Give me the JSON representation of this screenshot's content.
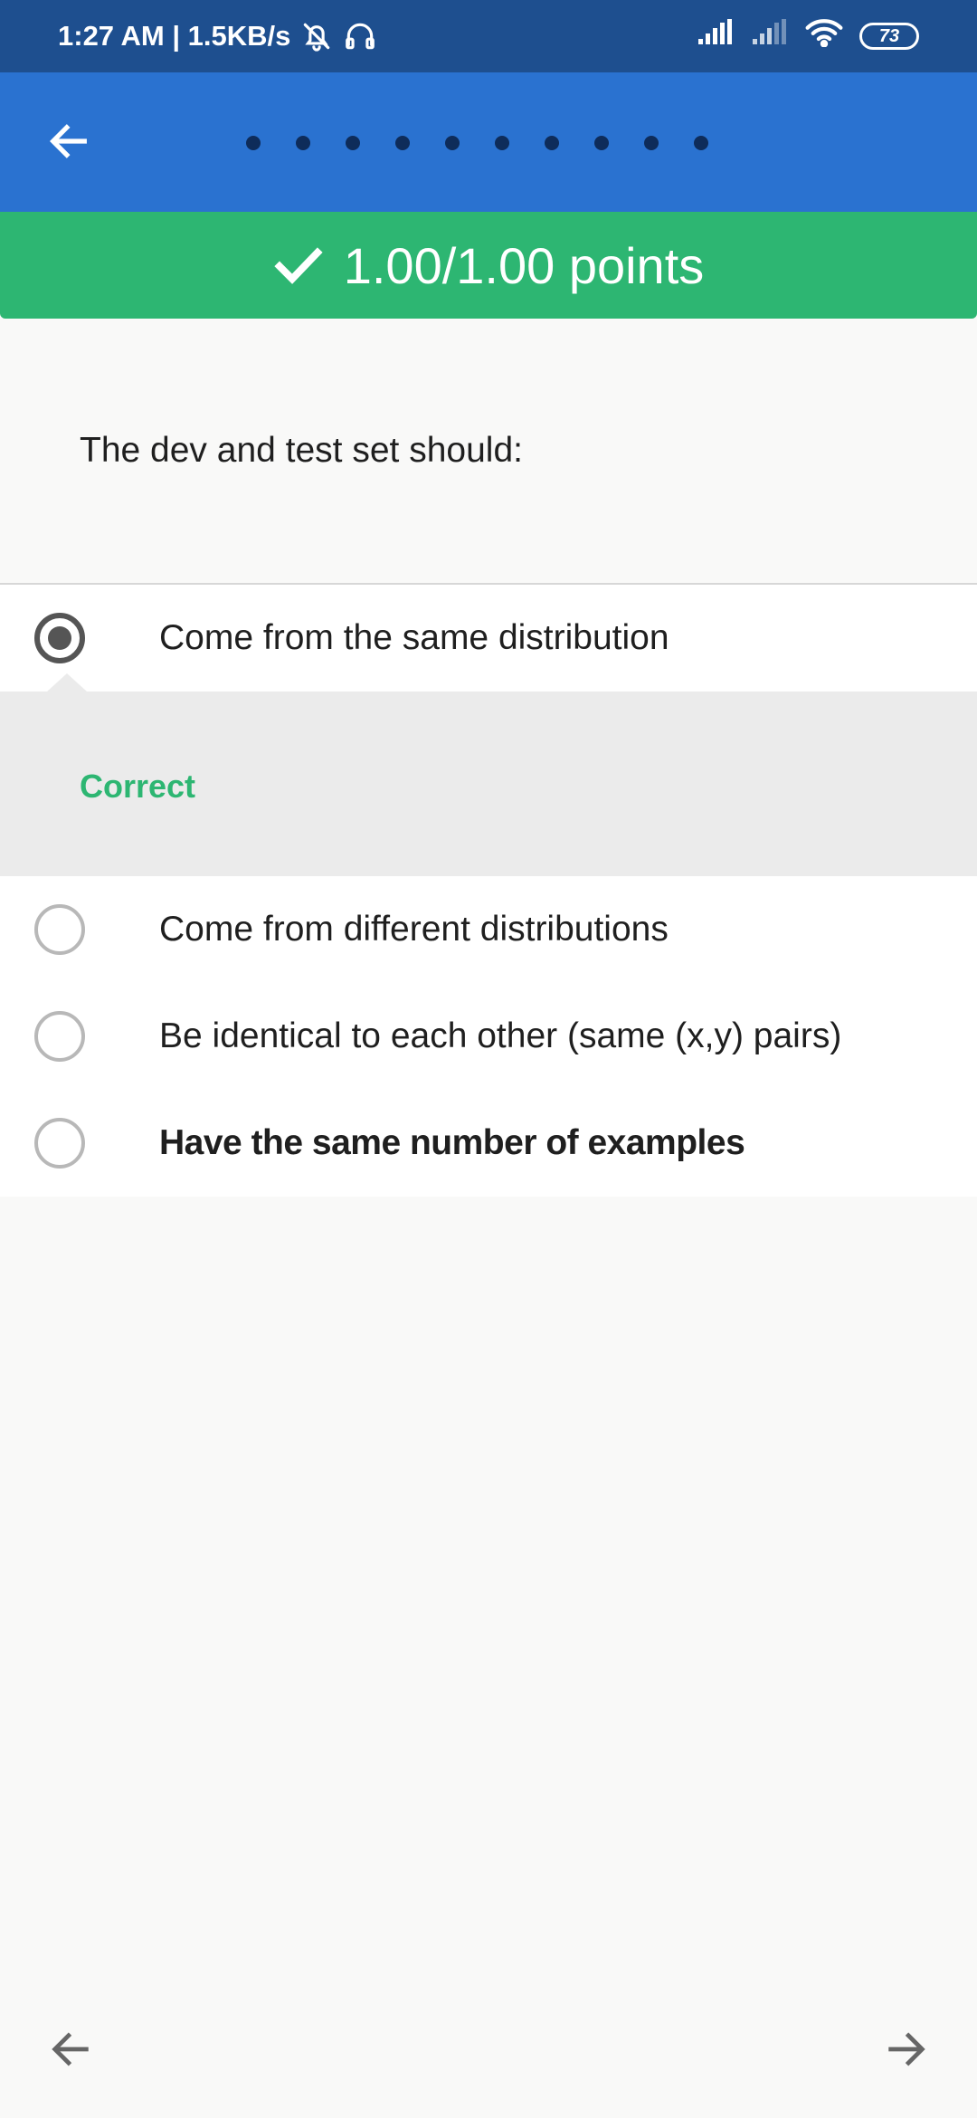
{
  "status_bar": {
    "time_speed": "1:27 AM | 1.5KB/s",
    "battery": "73"
  },
  "toolbar": {
    "page_dots": 10
  },
  "score_banner": {
    "text": "1.00/1.00 points"
  },
  "question": {
    "text": "The dev and test set should:"
  },
  "options": [
    {
      "label": "Come from the same distribution",
      "selected": true
    },
    {
      "label": "Come from different distributions",
      "selected": false
    },
    {
      "label": "Be identical to each other (same (x,y) pairs)",
      "selected": false
    },
    {
      "label": "Have the same number of examples",
      "selected": false
    }
  ],
  "feedback": {
    "text": "Correct"
  },
  "colors": {
    "status_bar": "#1e4f8f",
    "toolbar": "#2a72d0",
    "success": "#2db672"
  }
}
